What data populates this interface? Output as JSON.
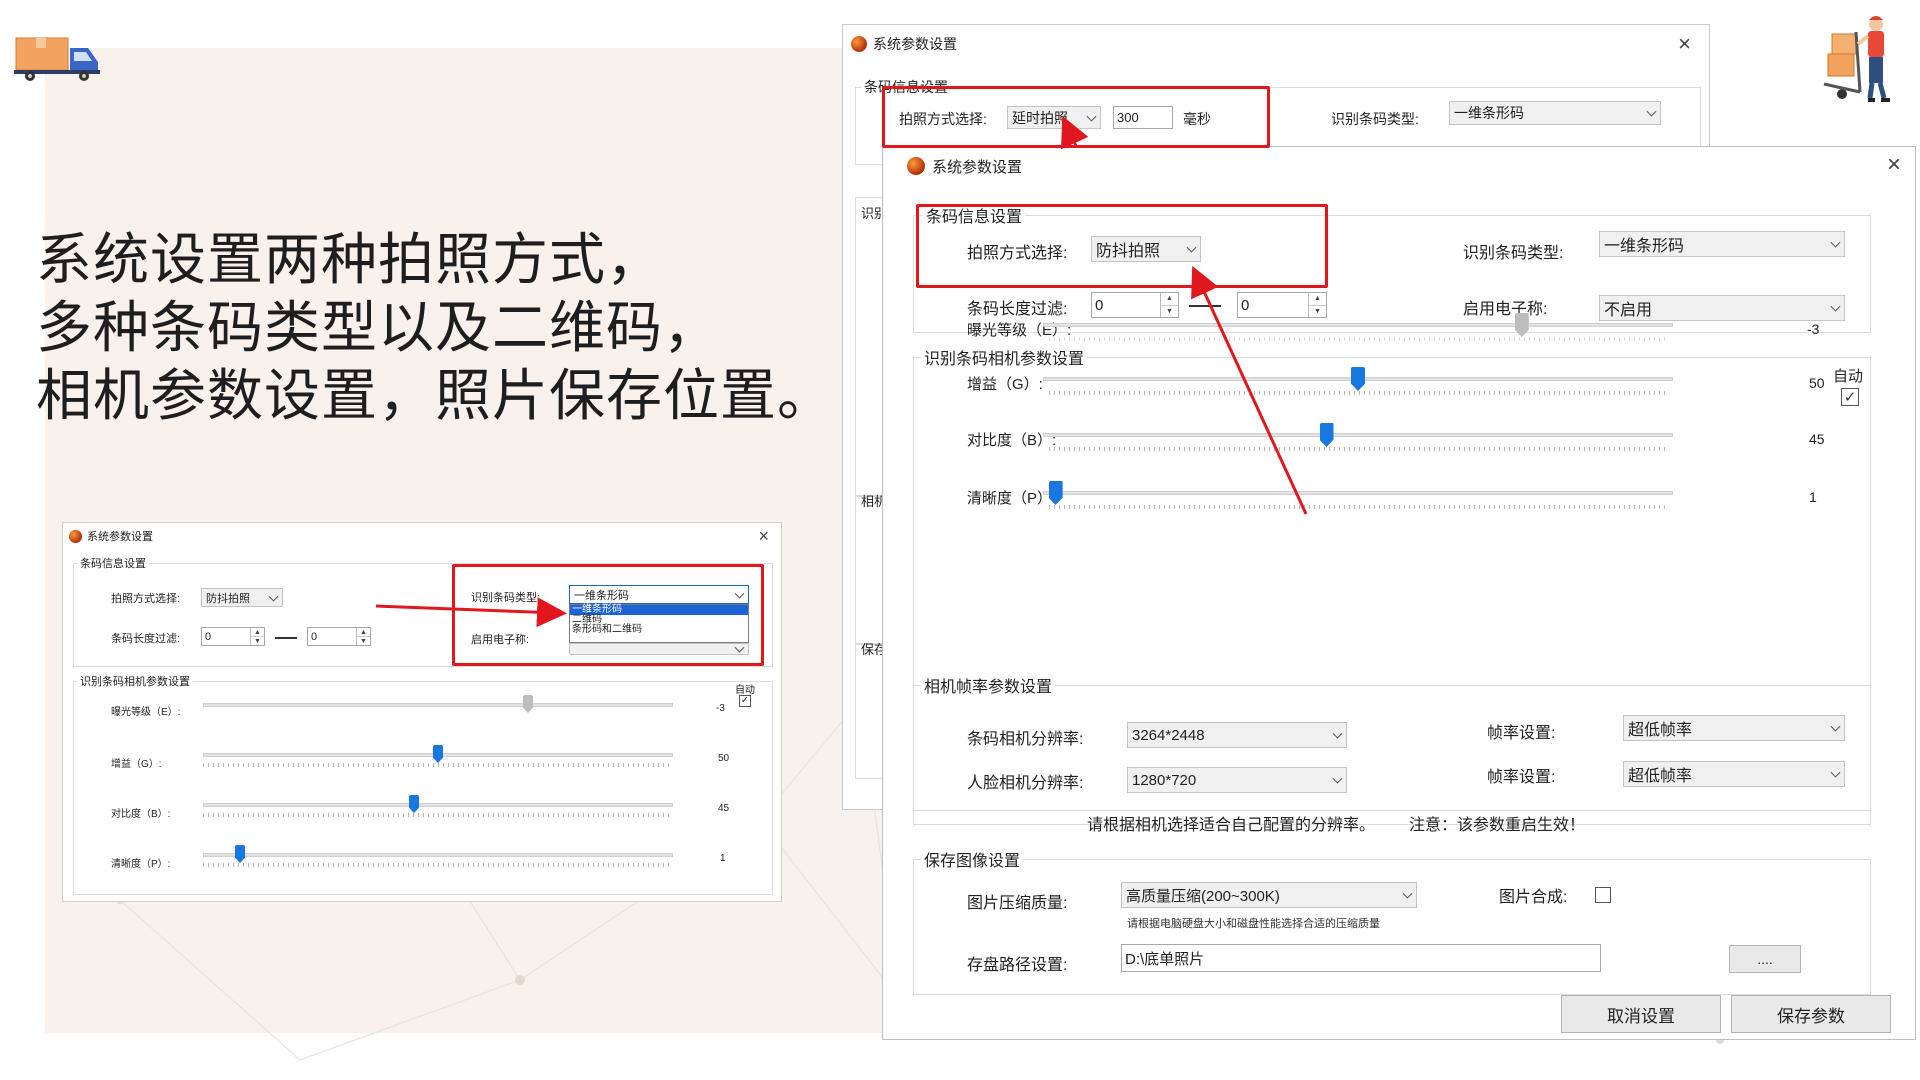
{
  "slide": {
    "headline_lines": [
      "系统设置两种拍照方式，",
      "多种条码类型以及二维码，",
      "相机参数设置，照片保存位置。"
    ],
    "icons": [
      "delivery-truck-icon",
      "courier-with-boxes-icon"
    ],
    "colors": {
      "panel": "#f8f1ec",
      "annotation_red": "#e0181e",
      "slider_blue": "#1877e0"
    }
  },
  "small_dialog": {
    "title": "系统参数设置",
    "close": "×",
    "barcode_group": "条码信息设置",
    "shoot_mode_label": "拍照方式选择:",
    "shoot_mode_value": "防抖拍照",
    "length_filter_label": "条码长度过滤:",
    "length_min": "0",
    "length_max": "0",
    "barcode_type_label": "识别条码类型:",
    "barcode_type_value": "一维条形码",
    "scale_label": "启用电子称:",
    "dropdown_options": [
      "一维条形码",
      "二维码",
      "条形码和二维码"
    ],
    "camera_group": "识别条码相机参数设置",
    "auto_label": "自动",
    "sliders": [
      {
        "label": "曝光等级（E）:",
        "value": "-3"
      },
      {
        "label": "增益（G）:",
        "value": "50"
      },
      {
        "label": "对比度（B）:",
        "value": "45"
      },
      {
        "label": "清晰度（P）:",
        "value": "1"
      }
    ]
  },
  "back_dialog": {
    "title": "系统参数设置",
    "close": "×",
    "barcode_group": "条码信息设置",
    "shoot_mode_label": "拍照方式选择:",
    "shoot_mode_value": "延时拍照",
    "delay_value": "300",
    "delay_unit": "毫秒",
    "barcode_type_label": "识别条码类型:",
    "barcode_type_value": "一维条形码",
    "side_labels": [
      "识别",
      "相机",
      "保存"
    ]
  },
  "main_dialog": {
    "title": "系统参数设置",
    "close": "×",
    "barcode_group": "条码信息设置",
    "shoot_mode_label": "拍照方式选择:",
    "shoot_mode_value": "防抖拍照",
    "barcode_type_label": "识别条码类型:",
    "barcode_type_value": "一维条形码",
    "length_filter_label": "条码长度过滤:",
    "length_min": "0",
    "length_max": "0",
    "scale_label": "启用电子称:",
    "scale_value": "不启用",
    "camera_group": "识别条码相机参数设置",
    "auto_label": "自动",
    "auto_checked": true,
    "sliders": [
      {
        "label": "曝光等级（E）:",
        "value": "-3",
        "pos": 0.76,
        "enabled": false
      },
      {
        "label": "增益（G）:",
        "value": "50",
        "pos": 0.5,
        "enabled": true
      },
      {
        "label": "对比度（B）:",
        "value": "45",
        "pos": 0.45,
        "enabled": true
      },
      {
        "label": "清晰度（P）:",
        "value": "1",
        "pos": 0.02,
        "enabled": true
      }
    ],
    "framerate_group": "相机帧率参数设置",
    "barcode_res_label": "条码相机分辨率:",
    "barcode_res_value": "3264*2448",
    "face_res_label": "人脸相机分辨率:",
    "face_res_value": "1280*720",
    "fps_label_1": "帧率设置:",
    "fps_value_1": "超低帧率",
    "fps_label_2": "帧率设置:",
    "fps_value_2": "超低帧率",
    "res_hint": "请根据相机选择适合自己配置的分辨率。",
    "restart_hint": "注意：该参数重启生效！",
    "image_group": "保存图像设置",
    "compress_label": "图片压缩质量:",
    "compress_value": "高质量压缩(200~300K)",
    "compress_hint": "请根据电脑硬盘大小和磁盘性能选择合适的压缩质量",
    "compose_label": "图片合成:",
    "path_label": "存盘路径设置:",
    "path_value": "D:\\底单照片",
    "browse_label": "....",
    "cancel_label": "取消设置",
    "save_label": "保存参数"
  }
}
